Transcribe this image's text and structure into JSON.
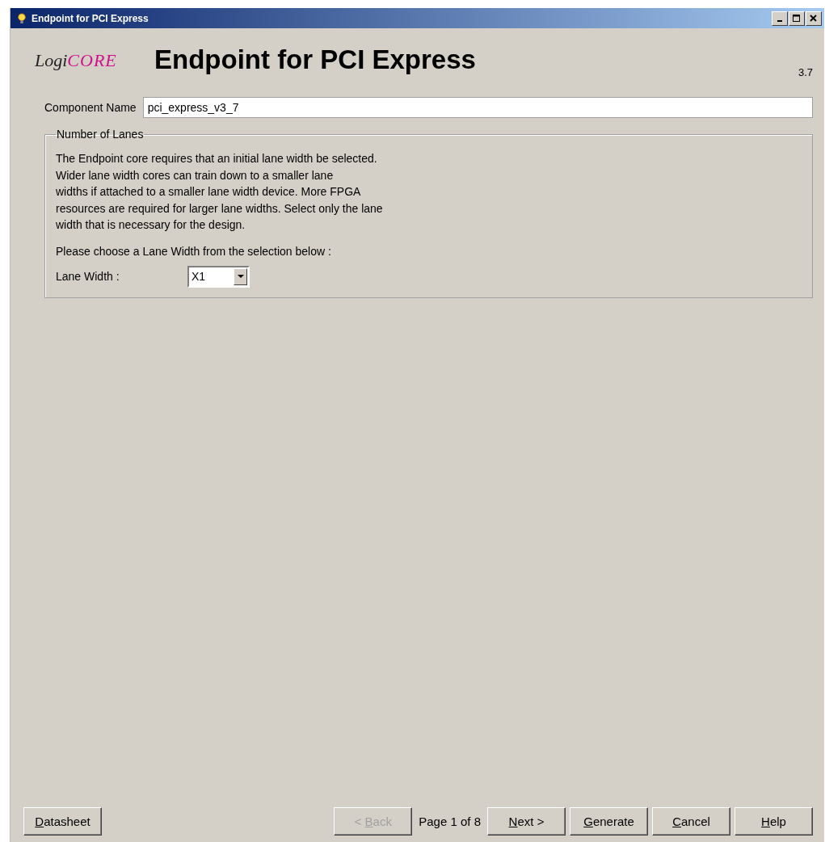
{
  "window": {
    "title": "Endpoint for PCI Express"
  },
  "logo": {
    "left": "Logi",
    "right": "CORE"
  },
  "heading": "Endpoint for PCI Express",
  "version": "3.7",
  "component_name": {
    "label": "Component Name",
    "value": "pci_express_v3_7"
  },
  "lanes_group": {
    "title": "Number of Lanes",
    "description_lines": [
      "The Endpoint core requires that an initial lane width be selected.",
      "Wider lane width cores can train down to a smaller lane",
      "widths if attached to a smaller lane width device.  More FPGA",
      "resources are required for larger lane widths.  Select only the lane",
      "width that is necessary for the design."
    ],
    "prompt": "Please choose a Lane Width from the selection below :",
    "lane_width": {
      "label": "Lane Width :",
      "value": "X1"
    }
  },
  "footer": {
    "datasheet": {
      "key": "D",
      "after": "atasheet",
      "disabled": false
    },
    "buttons": [
      {
        "before": "< ",
        "key": "B",
        "after": "ack",
        "disabled": true
      },
      {
        "kind": "page",
        "label": "Page 1 of 8"
      },
      {
        "key": "N",
        "after": "ext >",
        "disabled": false
      },
      {
        "key": "G",
        "after": "enerate",
        "disabled": false
      },
      {
        "key": "C",
        "after": "ancel",
        "disabled": false
      },
      {
        "key": "H",
        "after": "elp",
        "disabled": false
      }
    ]
  }
}
